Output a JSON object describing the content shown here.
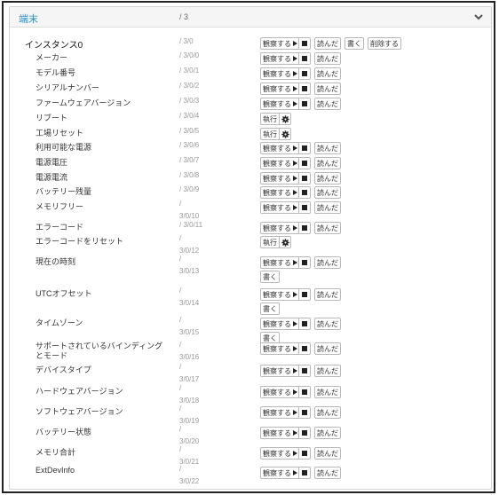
{
  "panel": {
    "title": "端末",
    "path": "/ 3"
  },
  "icons": {
    "collapse": "chevron-down-icon",
    "observe": "play-icon",
    "stop": "stop-icon",
    "execute": "gear-icon"
  },
  "buttons": {
    "observe": "観察する",
    "read": "読んだ",
    "write": "書く",
    "delete": "削除する",
    "execute": "執行"
  },
  "instance": {
    "label": "インスタンス0",
    "path": "/ 3/0"
  },
  "resources": [
    {
      "label": "メーカー",
      "path": "/ 3/0/0"
    },
    {
      "label": "モデル番号",
      "path": "/ 3/0/1"
    },
    {
      "label": "シリアルナンバー",
      "path": "/ 3/0/2"
    },
    {
      "label": "ファームウェアバージョン",
      "path": "/ 3/0/3"
    },
    {
      "label": "リブート",
      "path": "/ 3/0/4"
    },
    {
      "label": "工場リセット",
      "path": "/ 3/0/5"
    },
    {
      "label": "利用可能な電源",
      "path": "/ 3/0/6"
    },
    {
      "label": "電源電圧",
      "path": "/ 3/0/7"
    },
    {
      "label": "電源電流",
      "path": "/ 3/0/8"
    },
    {
      "label": "バッテリー残量",
      "path": "/ 3/0/9"
    },
    {
      "label": "メモリフリー",
      "path": "/ 3/0/10"
    },
    {
      "label": "エラーコード",
      "path": "/ 3/0/11"
    },
    {
      "label": "エラーコードをリセット",
      "path": "/ 3/0/12"
    },
    {
      "label": "現在の時刻",
      "path": "/ 3/0/13"
    },
    {
      "label": "UTCオフセット",
      "path": "/ 3/0/14"
    },
    {
      "label": "タイムゾーン",
      "path": "/ 3/0/15"
    },
    {
      "label": "サポートされているバインディングとモード",
      "path": "/ 3/0/16"
    },
    {
      "label": "デバイスタイプ",
      "path": "/ 3/0/17"
    },
    {
      "label": "ハードウェアバージョン",
      "path": "/ 3/0/18"
    },
    {
      "label": "ソフトウェアバージョン",
      "path": "/ 3/0/19"
    },
    {
      "label": "バッテリー状態",
      "path": "/ 3/0/20"
    },
    {
      "label": "メモリ合計",
      "path": "/ 3/0/21"
    },
    {
      "label": "ExtDevInfo",
      "path": "/ 3/0/22"
    }
  ]
}
